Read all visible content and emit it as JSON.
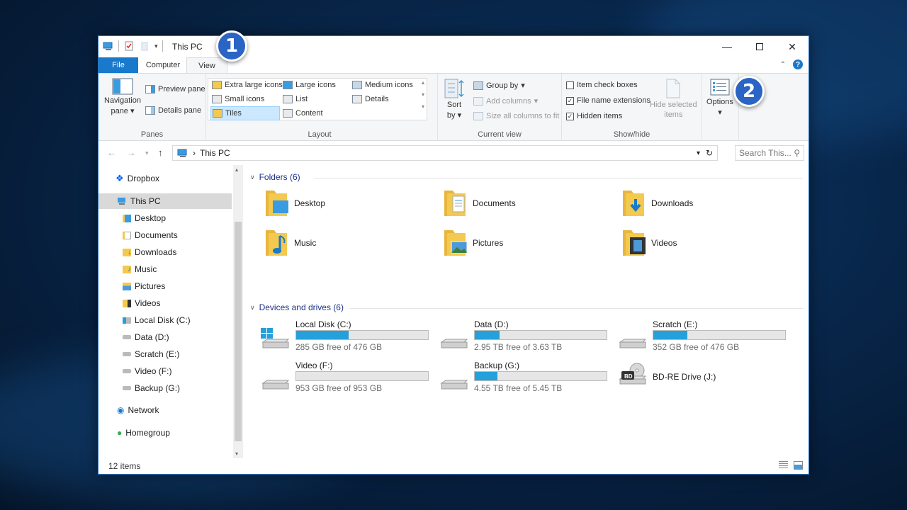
{
  "window": {
    "title": "This PC"
  },
  "callouts": {
    "one": "1",
    "two": "2"
  },
  "tabs": {
    "file": "File",
    "computer": "Computer",
    "view": "View"
  },
  "help": "?",
  "ribbon": {
    "panes": {
      "navigation_pane_1": "Navigation",
      "navigation_pane_2": "pane",
      "preview_pane": "Preview pane",
      "details_pane": "Details pane",
      "label": "Panes"
    },
    "layout": {
      "extra_large_icons": "Extra large icons",
      "large_icons": "Large icons",
      "medium_icons": "Medium icons",
      "small_icons": "Small icons",
      "list": "List",
      "details": "Details",
      "tiles": "Tiles",
      "content": "Content",
      "label": "Layout"
    },
    "current_view": {
      "sort_by_1": "Sort",
      "sort_by_2": "by",
      "group_by": "Group by",
      "add_columns": "Add columns",
      "size_all_columns": "Size all columns to fit",
      "label": "Current view"
    },
    "show_hide": {
      "item_check_boxes": "Item check boxes",
      "file_name_extensions": "File name extensions",
      "hidden_items": "Hidden items",
      "hide_selected_1": "Hide selected",
      "hide_selected_2": "items",
      "label": "Show/hide"
    },
    "options": "Options"
  },
  "address": {
    "path": "This PC",
    "search_placeholder": "Search This..."
  },
  "nav": {
    "dropbox": "Dropbox",
    "this_pc": "This PC",
    "desktop": "Desktop",
    "documents": "Documents",
    "downloads": "Downloads",
    "music": "Music",
    "pictures": "Pictures",
    "videos": "Videos",
    "local_disk": "Local Disk (C:)",
    "data": "Data (D:)",
    "scratch": "Scratch (E:)",
    "video": "Video (F:)",
    "backup": "Backup (G:)",
    "network": "Network",
    "homegroup": "Homegroup"
  },
  "sections": {
    "folders": "Folders (6)",
    "devices": "Devices and drives (6)"
  },
  "folders": {
    "desktop": "Desktop",
    "documents": "Documents",
    "downloads": "Downloads",
    "music": "Music",
    "pictures": "Pictures",
    "videos": "Videos"
  },
  "drives": {
    "c": {
      "name": "Local Disk (C:)",
      "free": "285 GB free of 476 GB",
      "used_fraction": 0.4
    },
    "d": {
      "name": "Data (D:)",
      "free": "2.95 TB free of 3.63 TB",
      "used_fraction": 0.19
    },
    "e": {
      "name": "Scratch (E:)",
      "free": "352 GB free of 476 GB",
      "used_fraction": 0.26
    },
    "f": {
      "name": "Video (F:)",
      "free": "953 GB free of 953 GB",
      "used_fraction": 0.0
    },
    "g": {
      "name": "Backup (G:)",
      "free": "4.55 TB free of 5.45 TB",
      "used_fraction": 0.17
    },
    "j": {
      "name": "BD-RE Drive (J:)",
      "disc_label": "BD"
    }
  },
  "status": {
    "count": "12 items"
  },
  "colors": {
    "accent": "#1979ca",
    "bar_fill": "#26a0da",
    "callout": "#2a64c4",
    "folder": "#f3c94f"
  }
}
